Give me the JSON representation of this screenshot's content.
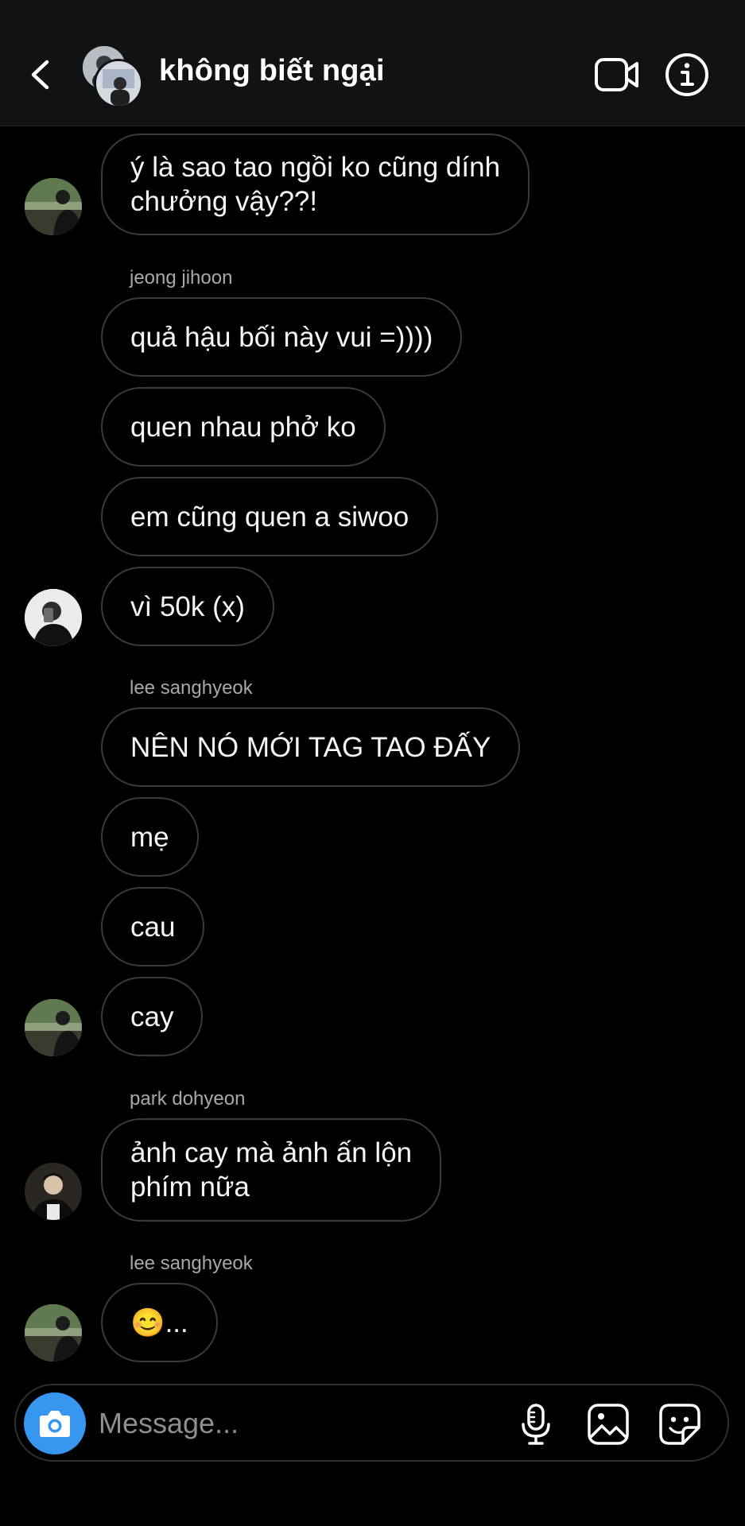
{
  "header": {
    "title": "không biết ngại"
  },
  "messages": [
    {
      "text": "ý là sao tao ngồi ko cũng dính\nchưởng vậy??!"
    },
    {
      "sender": "jeong jihoon"
    },
    {
      "text": "quả hậu bối này vui =))))"
    },
    {
      "text": "quen nhau phở ko"
    },
    {
      "text": "em cũng quen a siwoo"
    },
    {
      "text": "vì 50k (x)"
    },
    {
      "sender": "lee sanghyeok"
    },
    {
      "text": "NÊN NÓ MỚI TAG TAO ĐẤY"
    },
    {
      "text": "mẹ"
    },
    {
      "text": "cau"
    },
    {
      "text": "cay"
    },
    {
      "sender": "park dohyeon"
    },
    {
      "text": "ảnh cay mà ảnh ấn lộn\nphím nữa"
    },
    {
      "sender": "lee sanghyeok"
    },
    {
      "text": "😊..."
    }
  ],
  "composer": {
    "placeholder": "Message..."
  },
  "colors": {
    "accent": "#3797f0",
    "header_bg": "#121212",
    "bubble_border": "#3a3a3a",
    "sender_text": "#a8a8a8"
  }
}
